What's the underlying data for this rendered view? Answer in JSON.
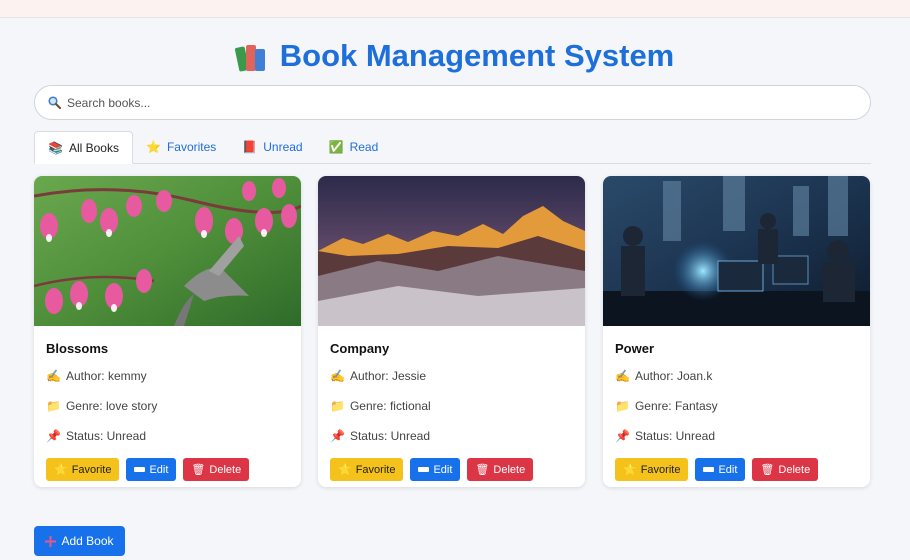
{
  "app": {
    "title": "Book Management System",
    "title_icon": "books-icon"
  },
  "search": {
    "placeholder": "Search books...",
    "value": "",
    "icon": "magnifier-icon"
  },
  "tabs": [
    {
      "label": "All Books",
      "icon": "📚",
      "active": true
    },
    {
      "label": "Favorites",
      "icon": "⭐",
      "active": false
    },
    {
      "label": "Unread",
      "icon": "📕",
      "active": false
    },
    {
      "label": "Read",
      "icon": "✅",
      "active": false
    }
  ],
  "labels": {
    "author_icon": "✍️",
    "genre_icon": "📁",
    "status_icon": "📌"
  },
  "books": [
    {
      "title": "Blossoms",
      "author": "Author: kemmy",
      "genre": "Genre: love story",
      "status": "Status: Unread",
      "image": "pink bleeding-heart flowers with hummingbird"
    },
    {
      "title": "Company",
      "author": "Author: Jessie",
      "genre": "Genre: fictional",
      "status": "Status: Unread",
      "image": "snowy mountain peaks at sunset"
    },
    {
      "title": "Power",
      "author": "Author: Joan.k",
      "genre": "Genre: Fantasy",
      "status": "Status: Unread",
      "image": "people working at laptops in office with city view"
    }
  ],
  "buttons": {
    "favorite": "Favorite",
    "favorite_icon": "⭐",
    "edit": "Edit",
    "delete": "Delete",
    "delete_icon": "🗑",
    "add_book": "Add Book"
  },
  "colors": {
    "accent": "#1e6fd9",
    "favorite": "#f5c21b",
    "edit": "#1671ea",
    "delete": "#dc3545"
  }
}
